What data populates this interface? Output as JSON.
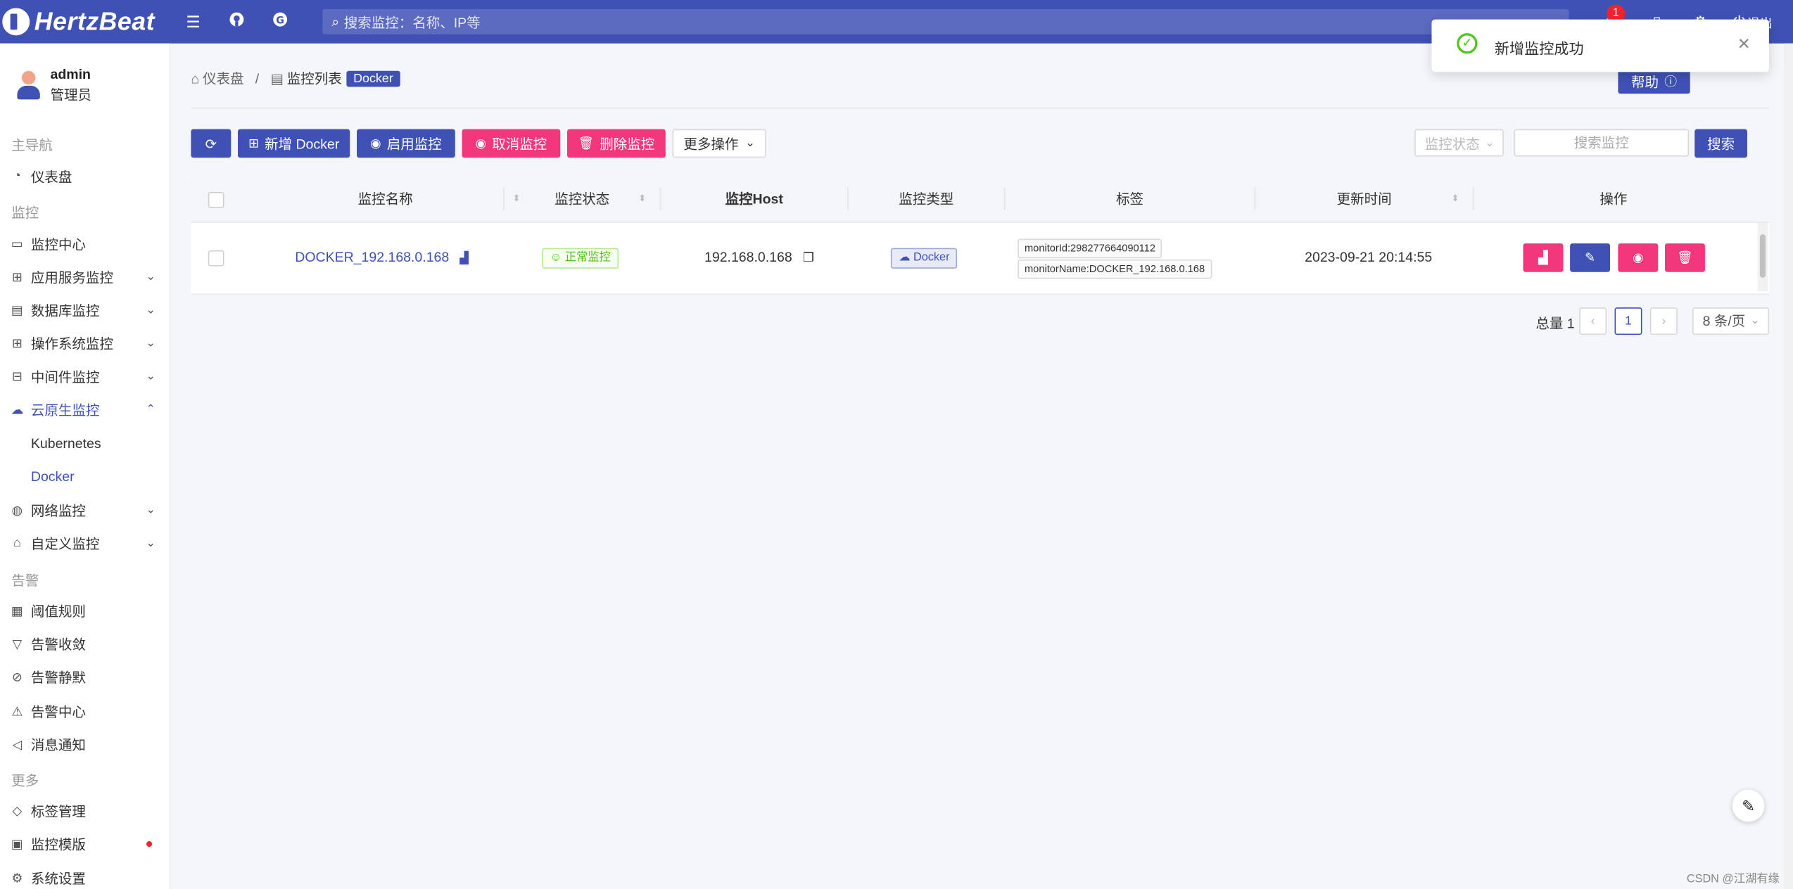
{
  "app": {
    "name": "HertzBeat"
  },
  "header": {
    "search_placeholder": "搜索监控：名称、IP等",
    "notification_count": "1",
    "logout_label": "退出"
  },
  "user": {
    "name": "admin",
    "role": "管理员"
  },
  "sidebar": {
    "groups": {
      "main": "主导航",
      "monitor": "监控",
      "alert": "告警",
      "more": "更多"
    },
    "items": {
      "dashboard": "仪表盘",
      "monitor_center": "监控中心",
      "app_service": "应用服务监控",
      "database": "数据库监控",
      "os": "操作系统监控",
      "middleware": "中间件监控",
      "cloud_native": "云原生监控",
      "kubernetes": "Kubernetes",
      "docker": "Docker",
      "network": "网络监控",
      "custom": "自定义监控",
      "threshold": "阈值规则",
      "converge": "告警收敛",
      "silence": "告警静默",
      "alert_center": "告警中心",
      "notify": "消息通知",
      "tags": "标签管理",
      "template": "监控模版",
      "settings": "系统设置"
    }
  },
  "breadcrumb": {
    "home": "仪表盘",
    "list": "监控列表",
    "type": "Docker"
  },
  "help_label": "帮助",
  "toolbar": {
    "add": "新增 Docker",
    "enable": "启用监控",
    "cancel": "取消监控",
    "delete": "删除监控",
    "more": "更多操作",
    "status_placeholder": "监控状态",
    "search_placeholder": "搜索监控",
    "search_button": "搜索"
  },
  "table": {
    "columns": [
      "监控名称",
      "监控状态",
      "监控Host",
      "监控类型",
      "标签",
      "更新时间",
      "操作"
    ],
    "rows": [
      {
        "name": "DOCKER_192.168.0.168",
        "status": "正常监控",
        "host": "192.168.0.168",
        "type": "Docker",
        "tags": [
          "monitorId:298277664090112",
          "monitorName:DOCKER_192.168.0.168"
        ],
        "updated": "2023-09-21 20:14:55"
      }
    ]
  },
  "pagination": {
    "total": "总量 1",
    "current": "1",
    "page_size": "8 条/页"
  },
  "toast": {
    "message": "新增监控成功"
  },
  "watermark": "CSDN @江湖有缘",
  "colors": {
    "primary": "#3f51b5",
    "danger": "#f3377d",
    "success": "#52c41a"
  },
  "icons": [
    "menu-fold-icon",
    "github-icon",
    "gitee-icon",
    "search-icon",
    "bell-icon",
    "lock-icon",
    "settings-icon",
    "logout-icon"
  ]
}
